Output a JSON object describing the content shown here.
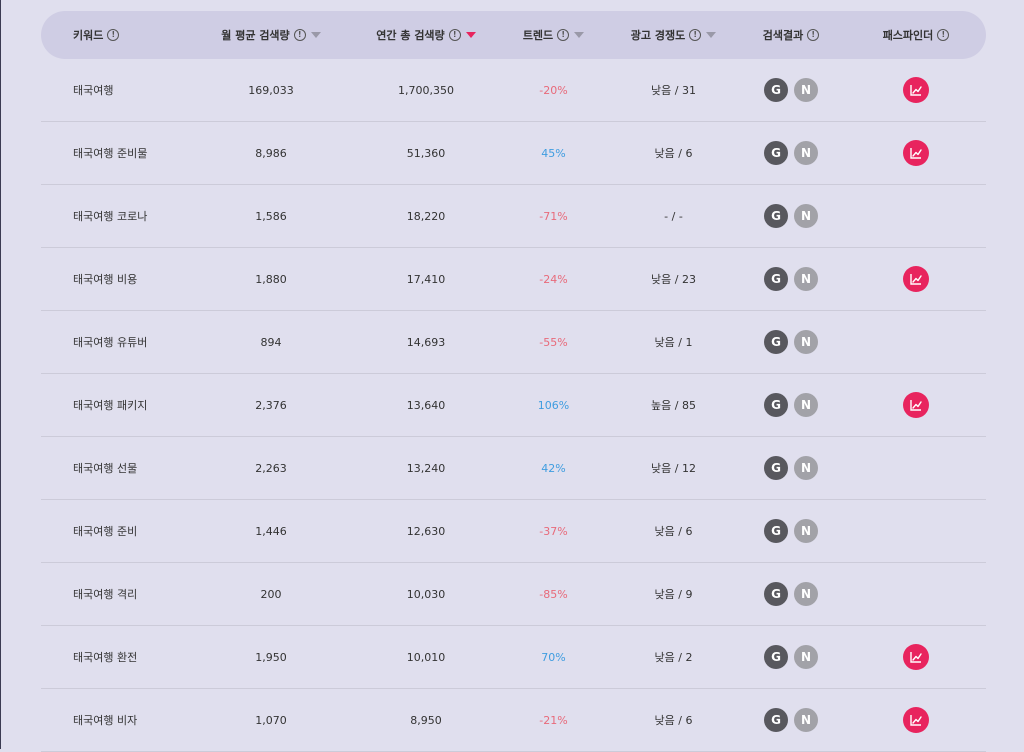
{
  "headers": {
    "keyword": "키워드",
    "monthly": "월 평균 검색량",
    "yearly": "연간 총 검색량",
    "trend": "트렌드",
    "competition": "광고 경쟁도",
    "results": "검색결과",
    "pathfinder": "패스파인더"
  },
  "icons": {
    "info": "info-circle-icon",
    "sort": "sort-down-triangle-icon",
    "google": "google-g-icon",
    "naver": "naver-n-icon",
    "pathfinder": "trend-chart-icon"
  },
  "colors": {
    "trend_negative": "#e86a7a",
    "trend_positive": "#3f9de0",
    "accent": "#e8245e",
    "google_badge": "#58585e",
    "naver_badge": "#a2a2a8"
  },
  "badges": {
    "google": "G",
    "naver": "N"
  },
  "rows": [
    {
      "keyword": "태국여행",
      "monthly": "169,033",
      "yearly": "1,700,350",
      "trend": "-20%",
      "competition": "낮음 / 31",
      "pathfinder": true
    },
    {
      "keyword": "태국여행 준비물",
      "monthly": "8,986",
      "yearly": "51,360",
      "trend": "45%",
      "competition": "낮음 / 6",
      "pathfinder": true
    },
    {
      "keyword": "태국여행 코로나",
      "monthly": "1,586",
      "yearly": "18,220",
      "trend": "-71%",
      "competition": "- / -",
      "pathfinder": false
    },
    {
      "keyword": "태국여행 비용",
      "monthly": "1,880",
      "yearly": "17,410",
      "trend": "-24%",
      "competition": "낮음 / 23",
      "pathfinder": true
    },
    {
      "keyword": "태국여행 유튜버",
      "monthly": "894",
      "yearly": "14,693",
      "trend": "-55%",
      "competition": "낮음 / 1",
      "pathfinder": false
    },
    {
      "keyword": "태국여행 패키지",
      "monthly": "2,376",
      "yearly": "13,640",
      "trend": "106%",
      "competition": "높음 / 85",
      "pathfinder": true
    },
    {
      "keyword": "태국여행 선물",
      "monthly": "2,263",
      "yearly": "13,240",
      "trend": "42%",
      "competition": "낮음 / 12",
      "pathfinder": false
    },
    {
      "keyword": "태국여행 준비",
      "monthly": "1,446",
      "yearly": "12,630",
      "trend": "-37%",
      "competition": "낮음 / 6",
      "pathfinder": false
    },
    {
      "keyword": "태국여행 격리",
      "monthly": "200",
      "yearly": "10,030",
      "trend": "-85%",
      "competition": "낮음 / 9",
      "pathfinder": false
    },
    {
      "keyword": "태국여행 환전",
      "monthly": "1,950",
      "yearly": "10,010",
      "trend": "70%",
      "competition": "낮음 / 2",
      "pathfinder": true
    },
    {
      "keyword": "태국여행 비자",
      "monthly": "1,070",
      "yearly": "8,950",
      "trend": "-21%",
      "competition": "낮음 / 6",
      "pathfinder": true
    }
  ]
}
